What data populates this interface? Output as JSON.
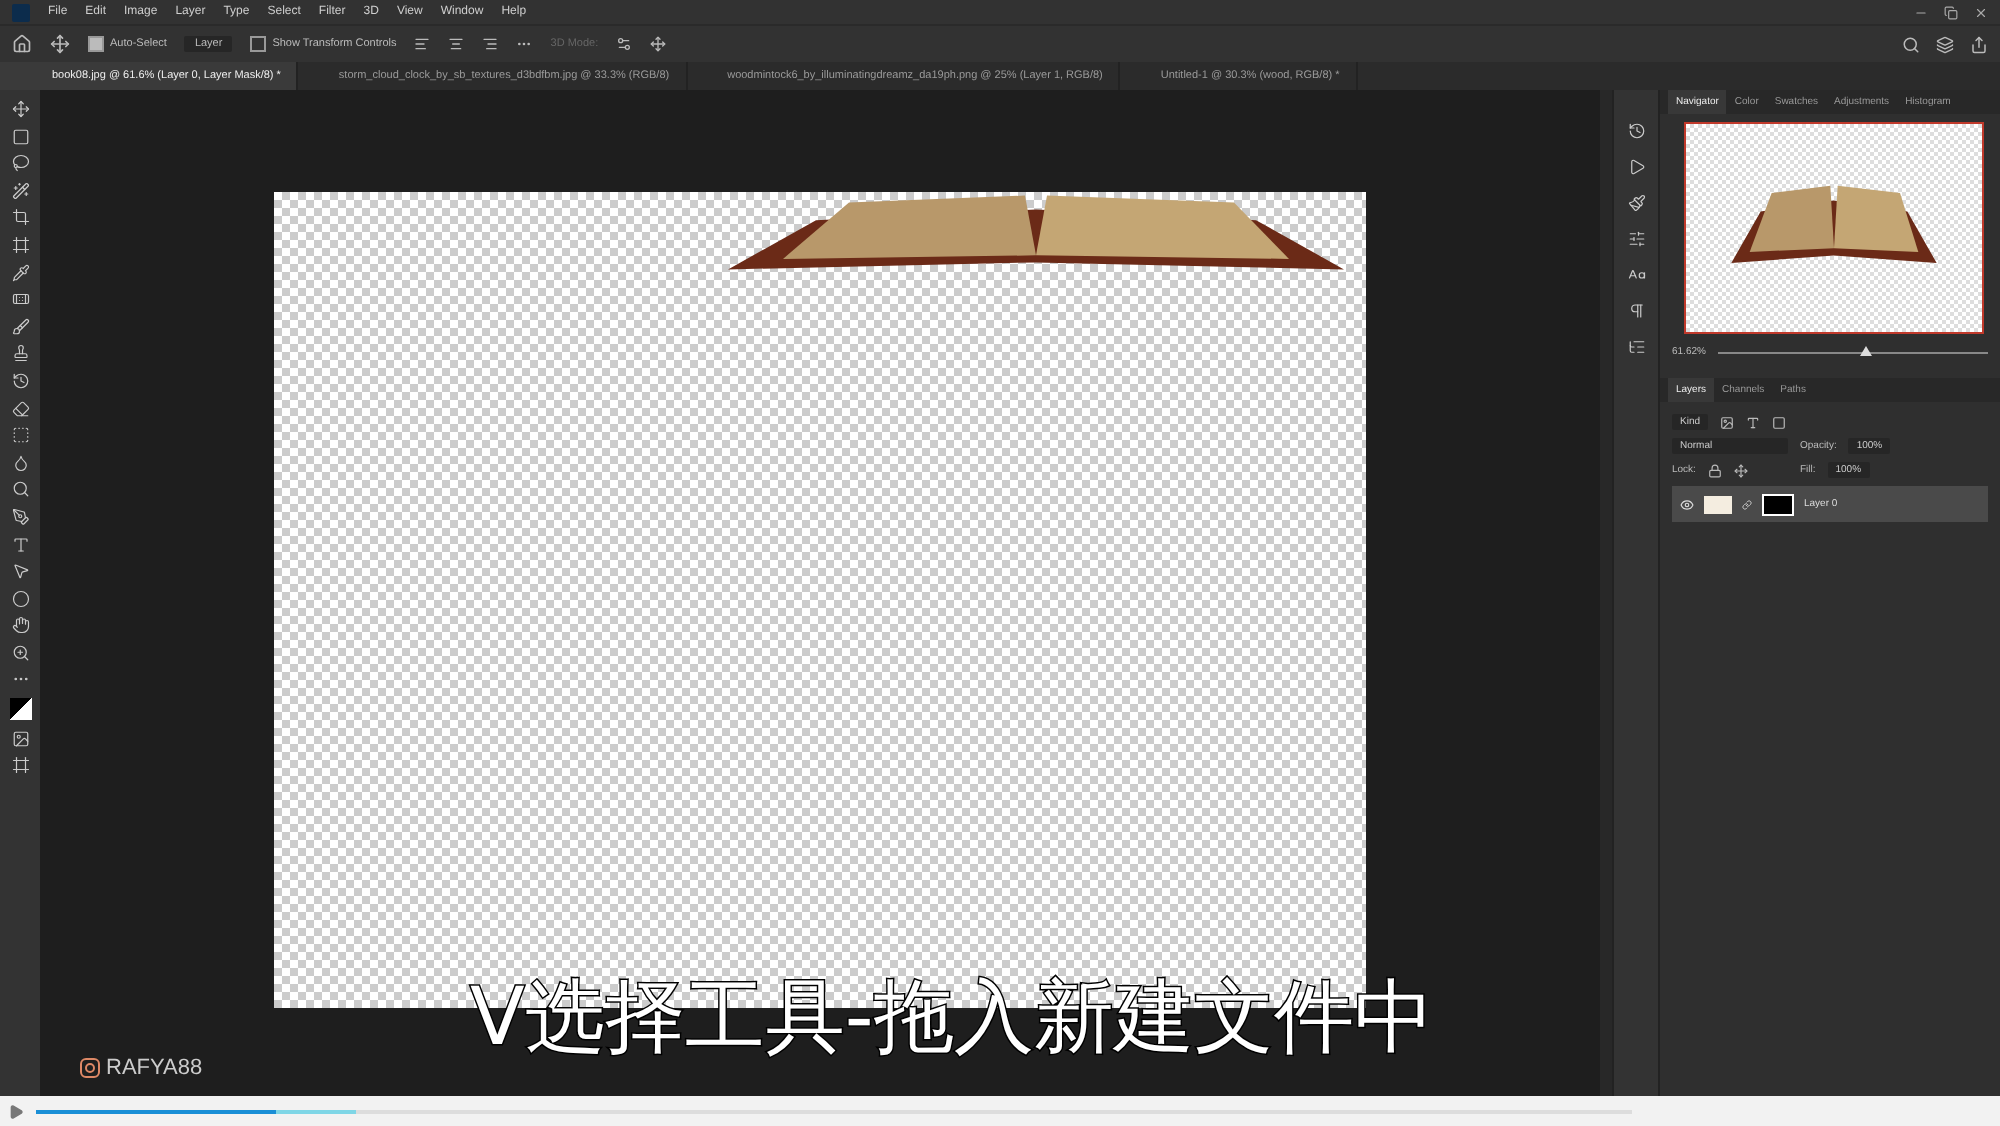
{
  "menu": [
    "File",
    "Edit",
    "Image",
    "Layer",
    "Type",
    "Select",
    "Filter",
    "3D",
    "View",
    "Window",
    "Help"
  ],
  "options_bar": {
    "auto_select": {
      "label": "Auto-Select",
      "checked": true
    },
    "target": "Layer",
    "transform_controls": {
      "label": "Show Transform Controls",
      "checked": false
    },
    "mode_label": "3D Mode:"
  },
  "document_tabs": [
    {
      "label": "book08.jpg @ 61.6% (Layer 0, Layer Mask/8) *",
      "selected": true
    },
    {
      "label": "storm_cloud_clock_by_sb_textures_d3bdfbm.jpg @ 33.3% (RGB/8)",
      "selected": false
    },
    {
      "label": "woodmintock6_by_illuminatingdreamz_da19ph.png @ 25% (Layer 1, RGB/8)",
      "selected": false
    },
    {
      "label": "Untitled-1 @ 30.3% (wood, RGB/8) *",
      "selected": false
    }
  ],
  "navigator": {
    "tabs": [
      {
        "label": "Navigator",
        "selected": true
      },
      {
        "label": "Color",
        "selected": false
      },
      {
        "label": "Swatches",
        "selected": false
      },
      {
        "label": "Adjustments",
        "selected": false
      },
      {
        "label": "Histogram",
        "selected": false
      }
    ],
    "zoom": "61.62%",
    "zoom_slider": {
      "level": 0.55
    }
  },
  "layers_panel": {
    "tabs": [
      {
        "label": "Layers",
        "selected": true
      },
      {
        "label": "Channels",
        "selected": false
      },
      {
        "label": "Paths",
        "selected": false
      }
    ],
    "filter": "Kind",
    "blend_mode": "Normal",
    "opacity_label": "Opacity:",
    "opacity": "100%",
    "lock_label": "Lock:",
    "fill_label": "Fill:",
    "fill": "100%",
    "layers": [
      {
        "name": "Layer 0",
        "selected": true,
        "visible": true
      }
    ]
  },
  "subtitle": "V选择工具-拖入新建文件中",
  "channel_tag": "RAFYA88",
  "player": {
    "progress": {
      "level": 0.15
    },
    "buffer": {
      "level": 0.2
    }
  }
}
